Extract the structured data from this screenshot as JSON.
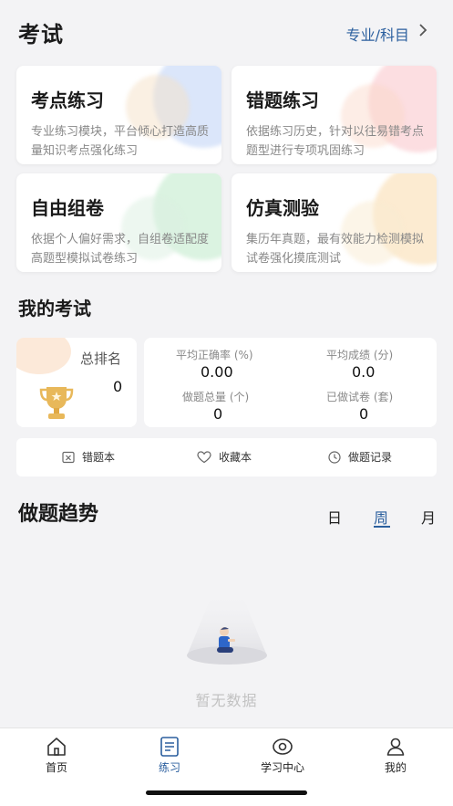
{
  "header": {
    "title": "考试",
    "subject_selector": "专业/科目"
  },
  "practice_cards": [
    {
      "title": "考点练习",
      "desc": "专业练习模块，平台倾心打造高质量知识考点强化练习"
    },
    {
      "title": "错题练习",
      "desc": "依据练习历史，针对以往易错考点题型进行专项巩固练习"
    },
    {
      "title": "自由组卷",
      "desc": "依据个人偏好需求，自组卷适配度高题型模拟试卷练习"
    },
    {
      "title": "仿真测验",
      "desc": "集历年真题，最有效能力检测模拟试卷强化摸底测试"
    }
  ],
  "my_exam": {
    "title": "我的考试",
    "rank_label": "总排名",
    "rank_value": "0",
    "stats": [
      {
        "label": "平均正确率 (%)",
        "value": "0.00"
      },
      {
        "label": "平均成绩 (分)",
        "value": "0.0"
      },
      {
        "label": "做题总量 (个)",
        "value": "0"
      },
      {
        "label": "已做试卷 (套)",
        "value": "0"
      }
    ]
  },
  "quick_links": [
    {
      "label": "错题本",
      "icon": "wrong-book-icon"
    },
    {
      "label": "收藏本",
      "icon": "heart-icon"
    },
    {
      "label": "做题记录",
      "icon": "clock-icon"
    }
  ],
  "trend": {
    "title": "做题趋势",
    "periods": [
      "日",
      "周",
      "月"
    ],
    "active_period": "周",
    "empty_text": "暂无数据"
  },
  "tabbar": [
    {
      "label": "首页",
      "icon": "home-icon"
    },
    {
      "label": "练习",
      "icon": "practice-icon"
    },
    {
      "label": "学习中心",
      "icon": "study-center-icon"
    },
    {
      "label": "我的",
      "icon": "profile-icon"
    }
  ],
  "colors": {
    "accent": "#2b5f9e",
    "background": "#f3f3f5"
  }
}
